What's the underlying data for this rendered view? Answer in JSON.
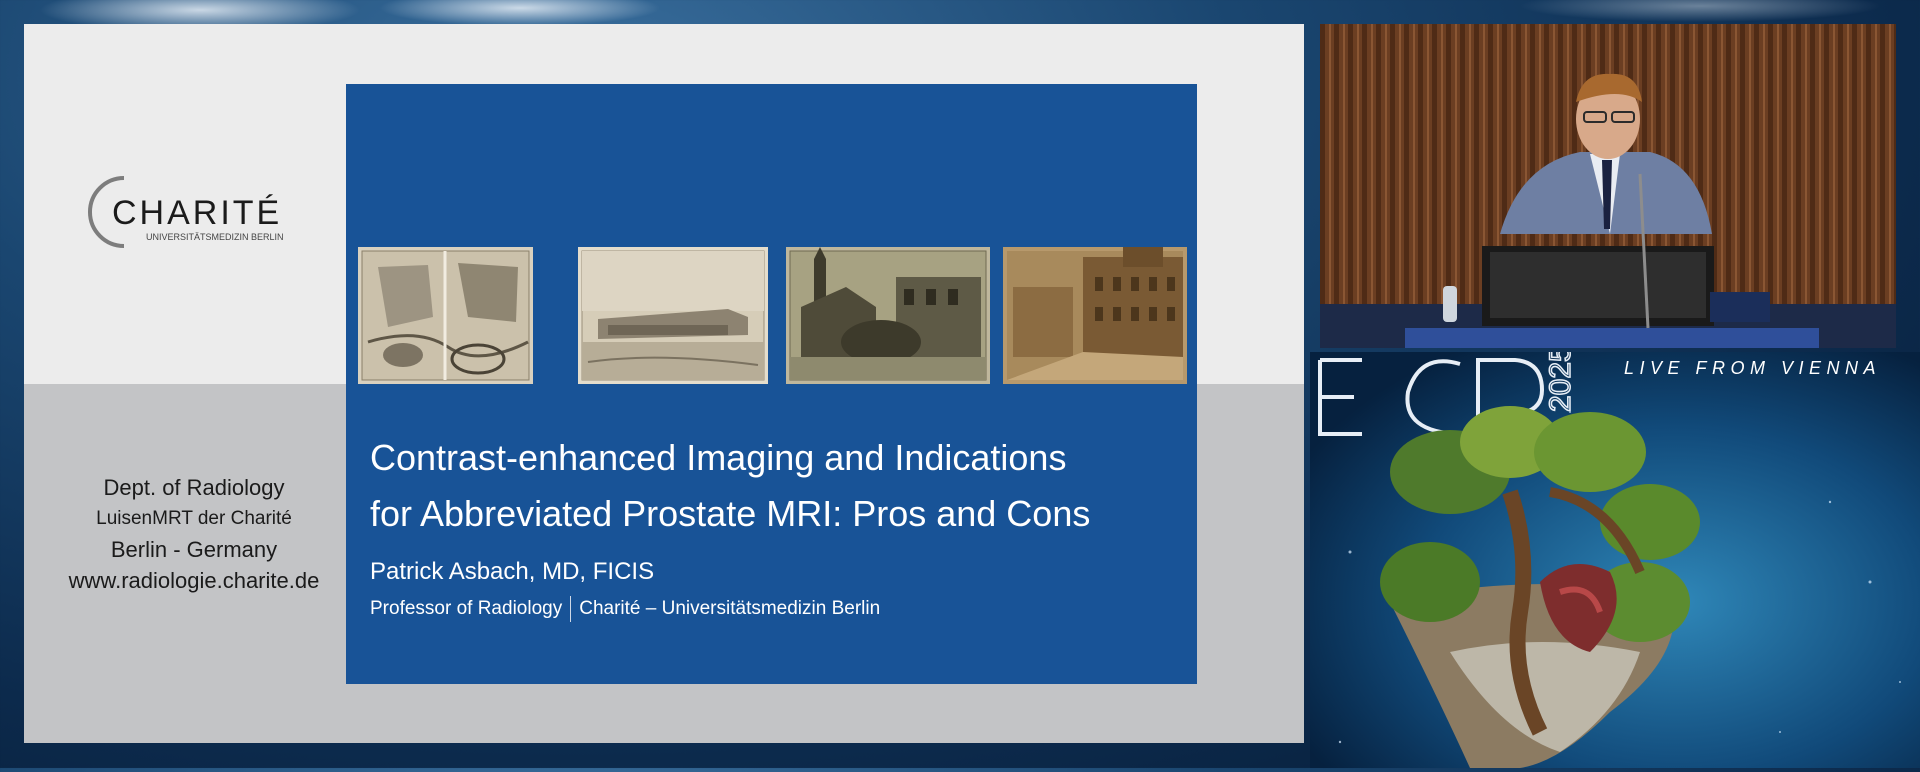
{
  "slide": {
    "logo": {
      "name": "CHARITÉ",
      "subtitle": "UNIVERSITÄTSMEDIZIN BERLIN"
    },
    "department": {
      "line1": "Dept. of Radiology",
      "line2": "LuisenMRT der Charité",
      "line3": "Berlin - Germany",
      "line4": "www.radiologie.charite.de"
    },
    "title_line1": "Contrast-enhanced Imaging and Indications",
    "title_line2": "for Abbreviated Prostate MRI: Pros and Cons",
    "author": "Patrick Asbach, MD, FICIS",
    "role": "Professor of Radiology",
    "institution": "Charité – Universitätsmedizin Berlin",
    "photos": [
      "historic-map-photo",
      "historic-building-photo",
      "historic-church-photo",
      "historic-street-photo"
    ]
  },
  "branding": {
    "tagline": "LIVE FROM VIENNA",
    "event_logo": "ECR",
    "year": "2025"
  },
  "video": {
    "content": "speaker-at-podium"
  },
  "colors": {
    "slide_blue": "#185397",
    "slide_light": "#ececec",
    "slide_grey": "#c3c4c6"
  }
}
